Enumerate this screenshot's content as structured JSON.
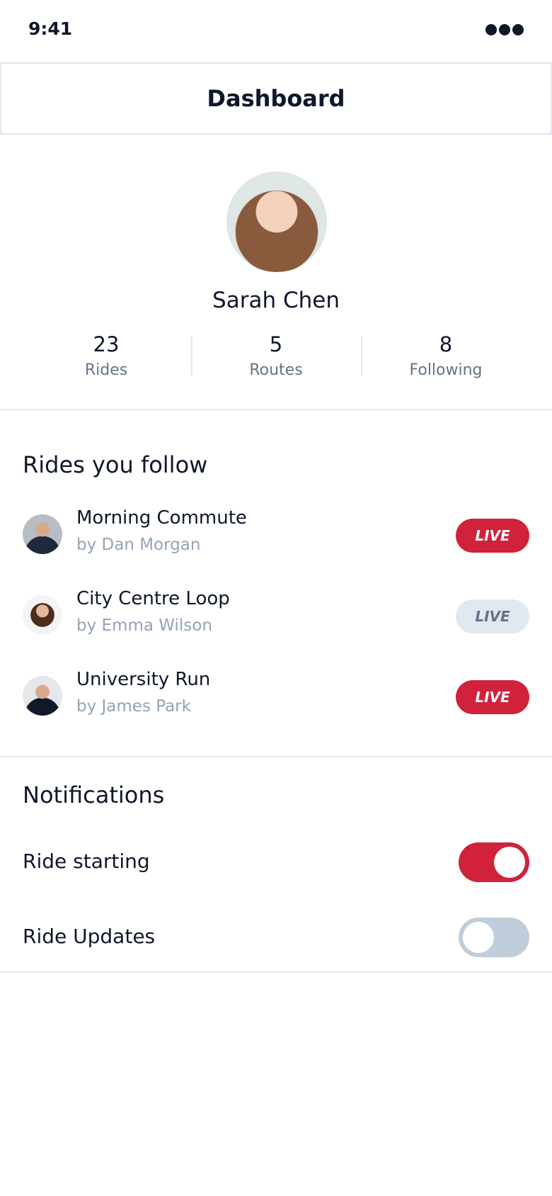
{
  "status_bar": {
    "time": "9:41",
    "menu_icon": "more-dots-icon"
  },
  "header": {
    "title": "Dashboard"
  },
  "profile": {
    "name": "Sarah Chen",
    "stats": [
      {
        "value": "23",
        "label": "Rides"
      },
      {
        "value": "5",
        "label": "Routes"
      },
      {
        "value": "8",
        "label": "Following"
      }
    ]
  },
  "rides": {
    "title": "Rides you follow",
    "items": [
      {
        "title": "Morning Commute",
        "author": "by Dan Morgan",
        "badge": "LIVE",
        "live": true
      },
      {
        "title": "City Centre Loop",
        "author": "by Emma Wilson",
        "badge": "LIVE",
        "live": false
      },
      {
        "title": "University Run",
        "author": "by James Park",
        "badge": "LIVE",
        "live": true
      }
    ]
  },
  "notifications": {
    "title": "Notifications",
    "items": [
      {
        "label": "Ride starting",
        "enabled": true
      },
      {
        "label": "Ride Updates",
        "enabled": false
      }
    ]
  },
  "colors": {
    "accent": "#d0223a",
    "muted": "#e2e8f0",
    "text": "#0f172a"
  }
}
